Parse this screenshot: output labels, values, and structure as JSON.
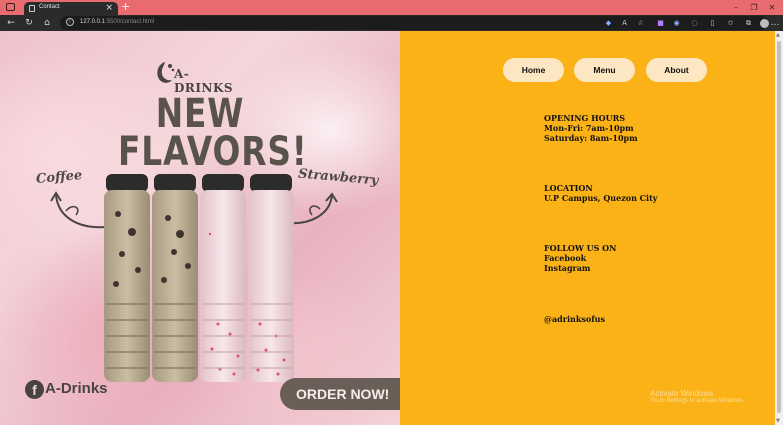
{
  "browser": {
    "tab_title": "Contact",
    "tab_close": "×",
    "new_tab": "+",
    "url_host": "127.0.0.1",
    "url_rest": ":5500/contact.html",
    "window_controls": [
      "–",
      "❐",
      "✕"
    ]
  },
  "poster": {
    "brand_name": "A-DRINKS",
    "headline_line1": "NEW",
    "headline_line2": "FLAVORS!",
    "flavor_left": "Coffee",
    "flavor_right": "Strawberry",
    "facebook_brand": "A-Drinks",
    "order_button": "ORDER NOW!",
    "colors": {
      "headline": "#5a534c",
      "coffee_milk": "#c6b79b",
      "strawberry_milk": "#f0d7dd",
      "cap": "#2c2c2c"
    }
  },
  "nav": {
    "items": [
      {
        "label": "Home"
      },
      {
        "label": "Menu"
      },
      {
        "label": "About"
      }
    ]
  },
  "contact": {
    "hours": {
      "heading": "OPENING HOURS",
      "lines": [
        "Mon-Fri: 7am-10pm",
        "Saturday: 8am-10pm"
      ]
    },
    "location": {
      "heading": "LOCATION",
      "lines": [
        "U.P Campus, Quezon City"
      ]
    },
    "social": {
      "heading": "FOLLOW US ON",
      "lines": [
        "Facebook",
        "Instagram"
      ]
    },
    "handle": "@adrinksofus"
  },
  "windows_watermark": {
    "title": "Activate Windows",
    "subtitle": "Go to Settings to activate Windows."
  },
  "theme": {
    "panel_bg": "#fbb216",
    "pill_bg": "#fde7c2",
    "titlebar": "#e86b6f"
  },
  "icons": [
    "back-icon",
    "forward-icon",
    "reload-icon",
    "home-icon",
    "info-icon",
    "extensions-icon",
    "favorites-icon",
    "profile-icon",
    "more-icon",
    "facebook-icon"
  ]
}
